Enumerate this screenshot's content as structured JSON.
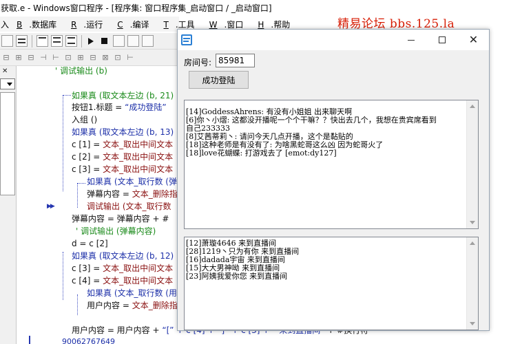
{
  "ide": {
    "title": "获取.e - Windows窗口程序 - [程序集: 窗口程序集_启动窗口 / _启动窗口]",
    "forum_label": "精易论坛 bbs.125.la",
    "menu": [
      {
        "prefix": "",
        "key": "B",
        "rest": ".数据库"
      },
      {
        "prefix": "",
        "key": "R",
        "rest": ".运行"
      },
      {
        "prefix": "",
        "key": "C",
        "rest": ".编译"
      },
      {
        "prefix": "",
        "key": "T",
        "rest": ".工具"
      },
      {
        "prefix": "",
        "key": "W",
        "rest": ".窗口"
      },
      {
        "prefix": "",
        "key": "H",
        "rest": ".帮助"
      }
    ],
    "menu_left_fragment": "入",
    "code": {
      "l1": "' 调试输出 (b)",
      "l2": "如果真 (取文本左边 (b, 21)",
      "l3a": "按钮1.标题 = ",
      "l3b": "“成功登陆”",
      "l4": "入组 ()",
      "l5": "如果真 (取文本左边 (b, 13)",
      "l6a": "c [1] = ",
      "l6b": "文本_取出中间文本",
      "l7a": "c [2] = ",
      "l7b": "文本_取出中间文本",
      "l8a": "c [3] = ",
      "l8b": "文本_取出中间文本",
      "l9": "如果真 (文本_取行数 (弹",
      "l10a": "弹幕内容 = ",
      "l10b": "文本_删除指",
      "l11": "调试输出 (文本_取行数",
      "l12a": "弹幕内容 = 弹幕内容 + #",
      "l13": "' 调试输出 (弹幕内容)",
      "l14": "d = c [2]",
      "l15": "如果真 (取文本左边 (b, 12)",
      "l16a": "c [3] = ",
      "l16b": "文本_取出中间文本",
      "l17a": "c [4] = ",
      "l17b": "文本_取出中间文本",
      "l18": "如果真 (文本_取行数 (用",
      "l19a": "用户内容 = ",
      "l19b": "文本_删除指",
      "l20a": "用户内容 = 用户内容 + ",
      "l20b": "“[” + c [4] + “]” + c [3] + “ 来到直播间”",
      "l20c": " + #换行符",
      "l21": "90062767649"
    }
  },
  "app_window": {
    "room_label": "房间号:",
    "room_value": "85981",
    "login_button": "成功登陆",
    "chat_messages": [
      "[14]GoddessAhrens: 有没有小姐姐 出来聊天啊",
      "[6]你丶小熠: 这都没开播呢一个个干嘛？？快出去几个，我想在贵宾席看到",
      "自己233333",
      "[8]艾茜蒂莉丶: 请问今天几点开播，这个是黏贴的",
      "[18]这种老师是有没有了: 为啥黑蛇哥这么凶 因为蛇哥火了",
      "[18]love花蝴蝶: 打游戏去了 [emot:dy127]"
    ],
    "enter_messages": [
      "[12]萧璇4646 来到直播间",
      "[28]1219丶只为有你 来到直播间",
      "[16]dadada宇宙 来到直播间",
      "[15]大大男神呦 来到直播间",
      "[23]阿姨我爱你您 来到直播间"
    ]
  },
  "colors": {
    "forum_red": "#d81e06",
    "keyword_green": "#1a8a1a",
    "string_blue": "#1c2fa8",
    "function_maroon": "#8a1111"
  },
  "icons": [
    "app-icon",
    "minimize-icon",
    "maximize-icon",
    "close-icon",
    "stop-icon",
    "run-icon",
    "breakpoint-arrow-icon"
  ]
}
